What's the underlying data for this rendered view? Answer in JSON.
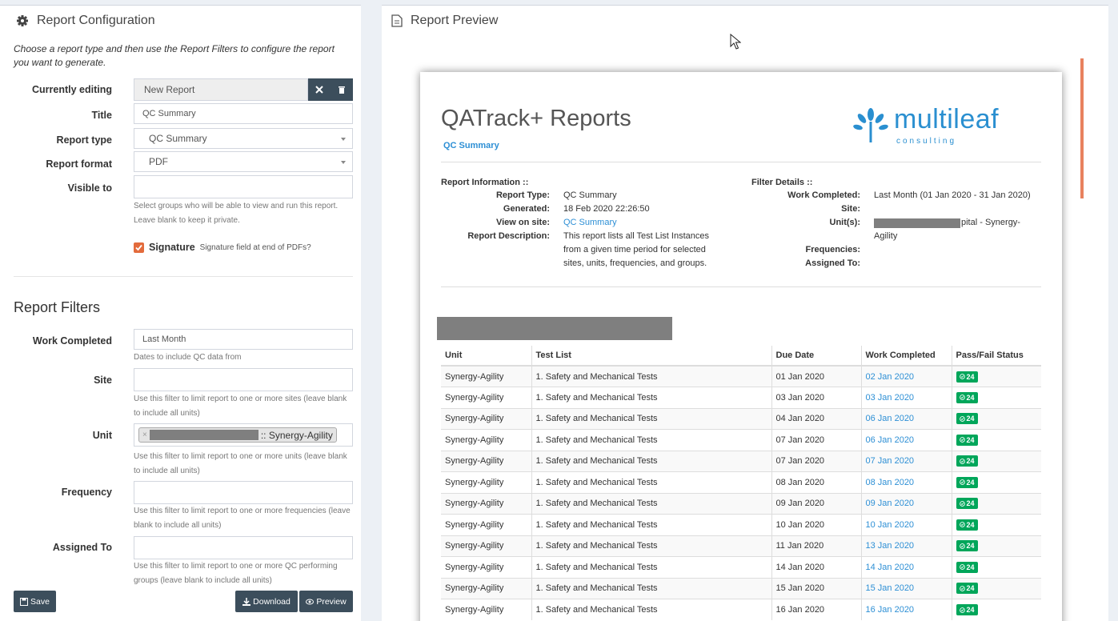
{
  "config": {
    "title": "Report Configuration",
    "intro": "Choose a report type and then use the Report Filters to configure the report you want to generate.",
    "currently_editing_label": "Currently editing",
    "currently_editing_value": "New Report",
    "title_label": "Title",
    "title_value": "QC Summary",
    "report_type_label": "Report type",
    "report_type_value": "QC Summary",
    "report_format_label": "Report format",
    "report_format_value": "PDF",
    "visible_to_label": "Visible to",
    "visible_to_help": "Select groups who will be able to view and run this report. Leave blank to keep it private.",
    "signature_label": "Signature",
    "signature_help": "Signature field at end of PDFs?"
  },
  "filters": {
    "title": "Report Filters",
    "work_completed_label": "Work Completed",
    "work_completed_value": "Last Month",
    "work_completed_help": "Dates to include QC data from",
    "site_label": "Site",
    "site_help": "Use this filter to limit report to one or more sites (leave blank to include all units)",
    "unit_label": "Unit",
    "unit_tag_suffix": ":: Synergy-Agility",
    "unit_help": "Use this filter to limit report to one or more units (leave blank to include all units)",
    "frequency_label": "Frequency",
    "frequency_help": "Use this filter to limit report to one or more frequencies (leave blank to include all units)",
    "assigned_to_label": "Assigned To",
    "assigned_to_help": "Use this filter to limit report to one or more QC performing groups (leave blank to include all units)"
  },
  "buttons": {
    "save": "Save",
    "download": "Download",
    "preview": "Preview"
  },
  "preview": {
    "title": "Report Preview",
    "report_title": "QATrack+ Reports",
    "report_subtitle": "QC Summary",
    "logo_text": "multileaf",
    "logo_sub": "consulting",
    "report_info_head": "Report Information ::",
    "filter_details_head": "Filter Details ::",
    "report_info": [
      {
        "key": "Report Type:",
        "value": "QC Summary"
      },
      {
        "key": "Generated:",
        "value": "18 Feb 2020 22:26:50"
      },
      {
        "key": "View on site:",
        "value": "QC Summary"
      },
      {
        "key": "Report Description:",
        "value": "This report lists all Test List Instances from a given time period for selected sites, units, frequencies, and groups."
      }
    ],
    "filter_details": [
      {
        "key": "Work Completed:",
        "value": "Last Month (01 Jan 2020 - 31 Jan 2020)"
      },
      {
        "key": "Site:",
        "value": ""
      },
      {
        "key": "Unit(s):",
        "value": "pital - Synergy-Agility"
      },
      {
        "key": "Frequencies:",
        "value": ""
      },
      {
        "key": "Assigned To:",
        "value": ""
      }
    ],
    "columns": [
      "Unit",
      "Test List",
      "Due Date",
      "Work Completed",
      "Pass/Fail Status"
    ],
    "rows": [
      {
        "unit": "Synergy-Agility",
        "test_list": "1. Safety and Mechanical Tests",
        "due": "01 Jan 2020",
        "completed": "02 Jan 2020",
        "status": "24"
      },
      {
        "unit": "Synergy-Agility",
        "test_list": "1. Safety and Mechanical Tests",
        "due": "03 Jan 2020",
        "completed": "03 Jan 2020",
        "status": "24"
      },
      {
        "unit": "Synergy-Agility",
        "test_list": "1. Safety and Mechanical Tests",
        "due": "04 Jan 2020",
        "completed": "06 Jan 2020",
        "status": "24"
      },
      {
        "unit": "Synergy-Agility",
        "test_list": "1. Safety and Mechanical Tests",
        "due": "07 Jan 2020",
        "completed": "06 Jan 2020",
        "status": "24"
      },
      {
        "unit": "Synergy-Agility",
        "test_list": "1. Safety and Mechanical Tests",
        "due": "07 Jan 2020",
        "completed": "07 Jan 2020",
        "status": "24"
      },
      {
        "unit": "Synergy-Agility",
        "test_list": "1. Safety and Mechanical Tests",
        "due": "08 Jan 2020",
        "completed": "08 Jan 2020",
        "status": "24"
      },
      {
        "unit": "Synergy-Agility",
        "test_list": "1. Safety and Mechanical Tests",
        "due": "09 Jan 2020",
        "completed": "09 Jan 2020",
        "status": "24"
      },
      {
        "unit": "Synergy-Agility",
        "test_list": "1. Safety and Mechanical Tests",
        "due": "10 Jan 2020",
        "completed": "10 Jan 2020",
        "status": "24"
      },
      {
        "unit": "Synergy-Agility",
        "test_list": "1. Safety and Mechanical Tests",
        "due": "11 Jan 2020",
        "completed": "13 Jan 2020",
        "status": "24"
      },
      {
        "unit": "Synergy-Agility",
        "test_list": "1. Safety and Mechanical Tests",
        "due": "14 Jan 2020",
        "completed": "14 Jan 2020",
        "status": "24"
      },
      {
        "unit": "Synergy-Agility",
        "test_list": "1. Safety and Mechanical Tests",
        "due": "15 Jan 2020",
        "completed": "15 Jan 2020",
        "status": "24"
      },
      {
        "unit": "Synergy-Agility",
        "test_list": "1. Safety and Mechanical Tests",
        "due": "16 Jan 2020",
        "completed": "16 Jan 2020",
        "status": "24"
      }
    ]
  },
  "colors": {
    "accent": "#2d8fd5",
    "button": "#3c4e5c",
    "pass_badge": "#00a65a",
    "checkbox": "#e36b3c"
  }
}
